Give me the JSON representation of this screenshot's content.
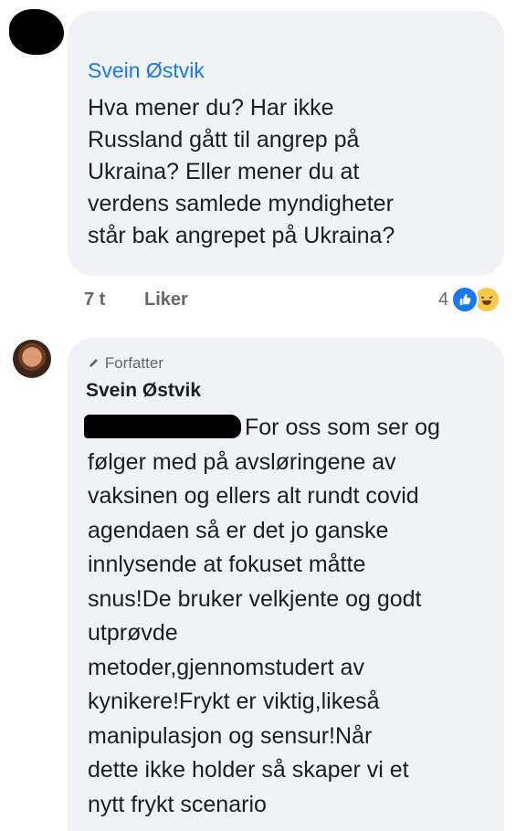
{
  "comment": {
    "author": "Svein Østvik",
    "text": "Hva mener du? Har ikke\nRussland gått til angrep på\nUkraina? Eller mener du at\nverdens samlede myndigheter\nstår bak angrepet på Ukraina?",
    "time": "7 t",
    "like_label": "Liker",
    "reaction_count": "4",
    "reaction_icons": [
      "like-icon",
      "haha-icon"
    ]
  },
  "reply": {
    "badge_label": "Forfatter",
    "badge_icon": "pencil-icon",
    "author": "Svein Østvik",
    "text": "For oss som ser og\nfølger med på avsløringene av\nvaksinen og ellers alt rundt covid\nagendaen så er det jo ganske\ninnlysende at fokuset måtte\nsnus!De bruker velkjente og godt\nutprøvde\nmetoder,gjennomstudert av\nkynikere!Frykt er viktig,likeså\nmanipulasjon og sensur!Når\ndette ikke holder så skaper vi et\nnytt frykt scenario"
  },
  "colors": {
    "link_blue": "#1877f2",
    "bubble_bg": "#f0f2f5",
    "meta_gray": "#65676b"
  }
}
